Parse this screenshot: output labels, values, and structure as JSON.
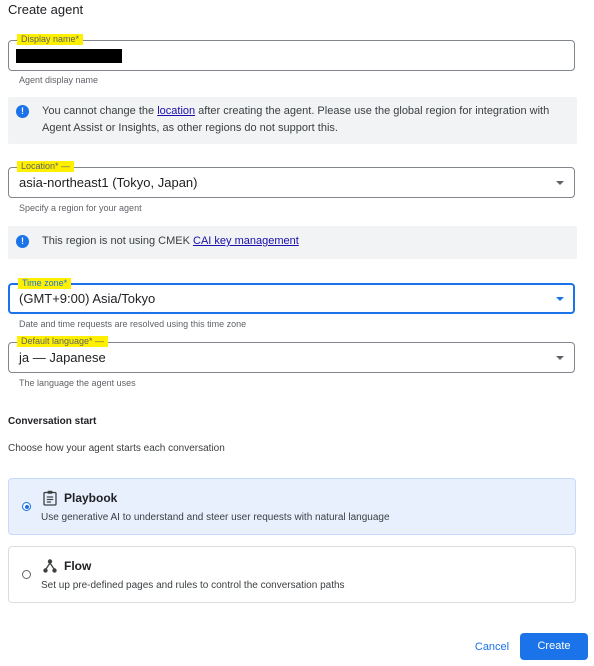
{
  "page": {
    "title": "Create agent"
  },
  "display_name": {
    "label": "Display name*",
    "hint": "Agent display name"
  },
  "location_banner": {
    "text_before": "You cannot change the ",
    "link": "location",
    "text_after": " after creating the agent. Please use the global region for integration with Agent Assist or Insights, as other regions do not support this."
  },
  "location": {
    "label": "Location* —",
    "value": "asia-northeast1 (Tokyo, Japan)",
    "hint": "Specify a region for your agent"
  },
  "cmek_banner": {
    "text": "This region is not using CMEK ",
    "link": "CAI key management"
  },
  "time_zone": {
    "label": "Time zone*",
    "value": "(GMT+9:00) Asia/Tokyo",
    "hint": "Date and time requests are resolved using this time zone"
  },
  "default_language": {
    "label": "Default language* —",
    "value": "ja — Japanese",
    "hint": "The language the agent uses"
  },
  "conversation_start": {
    "title": "Conversation start",
    "description": "Choose how your agent starts each conversation",
    "options": [
      {
        "title": "Playbook",
        "description": "Use generative AI to understand and steer user requests with natural language",
        "selected": true,
        "icon": "clipboard-icon"
      },
      {
        "title": "Flow",
        "description": "Set up pre-defined pages and rules to control the conversation paths",
        "selected": false,
        "icon": "flow-icon"
      }
    ]
  },
  "actions": {
    "cancel": "Cancel",
    "create": "Create"
  },
  "colors": {
    "accent": "#1a73e8",
    "highlight": "#fff000",
    "selected_card": "#e8f0fe"
  }
}
